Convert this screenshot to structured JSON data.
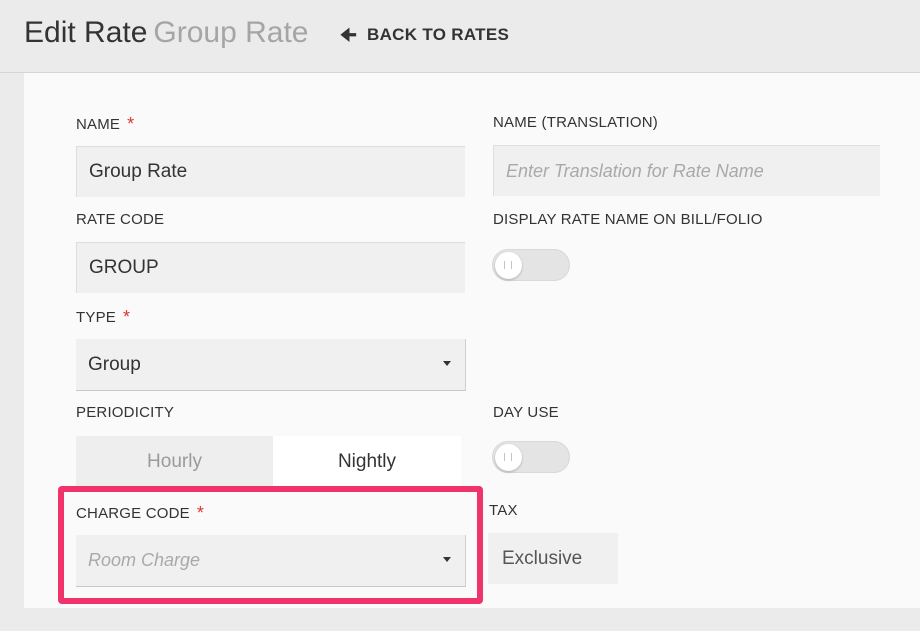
{
  "header": {
    "title": "Edit Rate",
    "subtitle": "Group Rate",
    "back_label": "BACK TO RATES",
    "back_icon": "arrow-left-icon"
  },
  "form": {
    "name": {
      "label": "NAME",
      "required_mark": "*",
      "value": "Group Rate"
    },
    "name_translation": {
      "label": "NAME (TRANSLATION)",
      "placeholder": "Enter Translation for Rate Name"
    },
    "rate_code": {
      "label": "RATE CODE",
      "value": "GROUP"
    },
    "display_rate_name": {
      "label": "DISPLAY RATE NAME ON BILL/FOLIO",
      "on": false
    },
    "type": {
      "label": "TYPE",
      "required_mark": "*",
      "value": "Group"
    },
    "periodicity": {
      "label": "PERIODICITY",
      "options": [
        "Hourly",
        "Nightly"
      ],
      "selected": "Nightly"
    },
    "day_use": {
      "label": "DAY USE",
      "on": false
    },
    "charge_code": {
      "label": "CHARGE CODE",
      "required_mark": "*",
      "placeholder": "Room Charge"
    },
    "tax": {
      "label": "TAX",
      "value": "Exclusive"
    }
  },
  "colors": {
    "required": "#e3342f",
    "highlight": "#f0336b",
    "background": "#ebebeb",
    "card": "#fafafa"
  }
}
